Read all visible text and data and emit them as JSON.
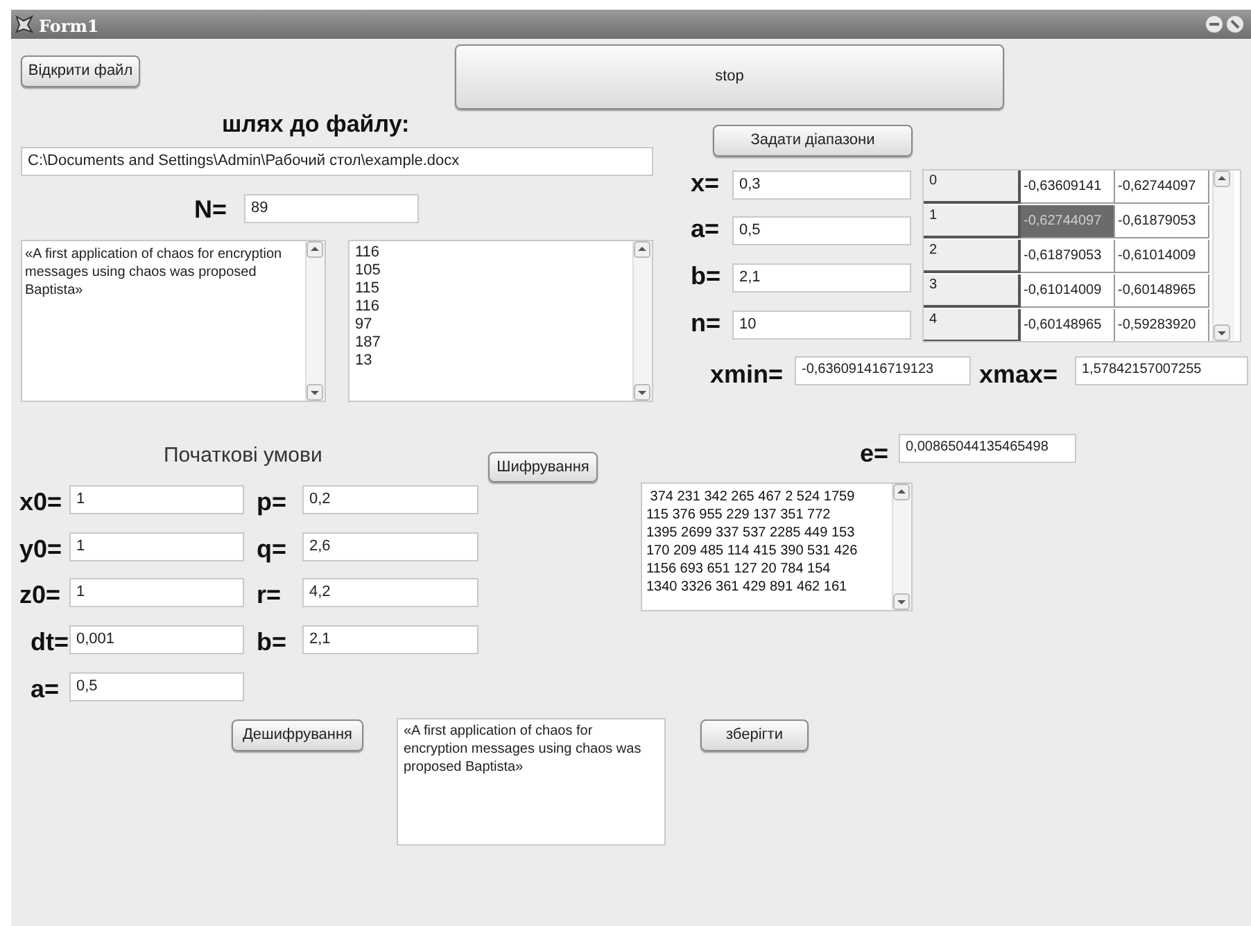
{
  "window": {
    "title": "Form1"
  },
  "open_button": "Відкрити файл",
  "stop_button": "stop",
  "path_label": "шлях до файлу:",
  "path_field": "C:\\Documents and Settings\\Admin\\Рабочий стол\\example.docx",
  "n": {
    "label": "N=",
    "value": "89"
  },
  "source_text": "«A first application of chaos for encryption messages using chaos was proposed Baptista»",
  "codes": [
    "116",
    "105",
    "115",
    "116",
    "97",
    "187",
    "13"
  ],
  "range_button": "Задати діапазони",
  "params": [
    {
      "label": "x=",
      "value": "0,3"
    },
    {
      "label": "a=",
      "value": "0,5"
    },
    {
      "label": "b=",
      "value": "2,1"
    },
    {
      "label": "n=",
      "value": "10"
    }
  ],
  "grid": {
    "rows": [
      {
        "index": "0",
        "cells": [
          {
            "text": "-0,63609141",
            "selected": false
          },
          {
            "text": "-0,62744097",
            "selected": false
          }
        ]
      },
      {
        "index": "1",
        "cells": [
          {
            "text": "-0,62744097",
            "selected": true
          },
          {
            "text": "-0,61879053",
            "selected": false
          }
        ]
      },
      {
        "index": "2",
        "cells": [
          {
            "text": "-0,61879053",
            "selected": false
          },
          {
            "text": "-0,61014009",
            "selected": false
          }
        ]
      },
      {
        "index": "3",
        "cells": [
          {
            "text": "-0,61014009",
            "selected": false
          },
          {
            "text": "-0,60148965",
            "selected": false
          }
        ]
      },
      {
        "index": "4",
        "cells": [
          {
            "text": "-0,60148965",
            "selected": false
          },
          {
            "text": "-0,59283920",
            "selected": false
          }
        ]
      }
    ]
  },
  "xmin": {
    "label": "xmin=",
    "value": "-0,636091416719123"
  },
  "xmax": {
    "label": "xmax=",
    "value": "1,57842157007255"
  },
  "e": {
    "label": "e=",
    "value": "0,00865044135465498"
  },
  "initial_label": "Початкові умови",
  "encrypt_button": "Шифрування",
  "initial_left": [
    {
      "label": "x0=",
      "value": "1"
    },
    {
      "label": "y0=",
      "value": "1"
    },
    {
      "label": "z0=",
      "value": "1"
    },
    {
      "label": "dt=",
      "value": "0,001"
    },
    {
      "label": "a=",
      "value": "0,5"
    }
  ],
  "initial_right": [
    {
      "label": "p=",
      "value": "0,2"
    },
    {
      "label": "q=",
      "value": "2,6"
    },
    {
      "label": "r=",
      "value": "4,2"
    },
    {
      "label": "b=",
      "value": "2,1"
    }
  ],
  "cipher_lines": [
    " 374 231 342 265 467 2 524 1759",
    "115 376 955 229 137 351 772",
    "1395 2699 337 537 2285 449 153",
    "170 209 485 114 415 390 531 426",
    "1156 693 651 127 20 784 154",
    "1340 3326 361 429 891 462 161"
  ],
  "decrypt_button": "Дешифрування",
  "decrypted_text": "«A first application of chaos for encryption messages using chaos was proposed Baptista»",
  "save_button": "зберігти"
}
